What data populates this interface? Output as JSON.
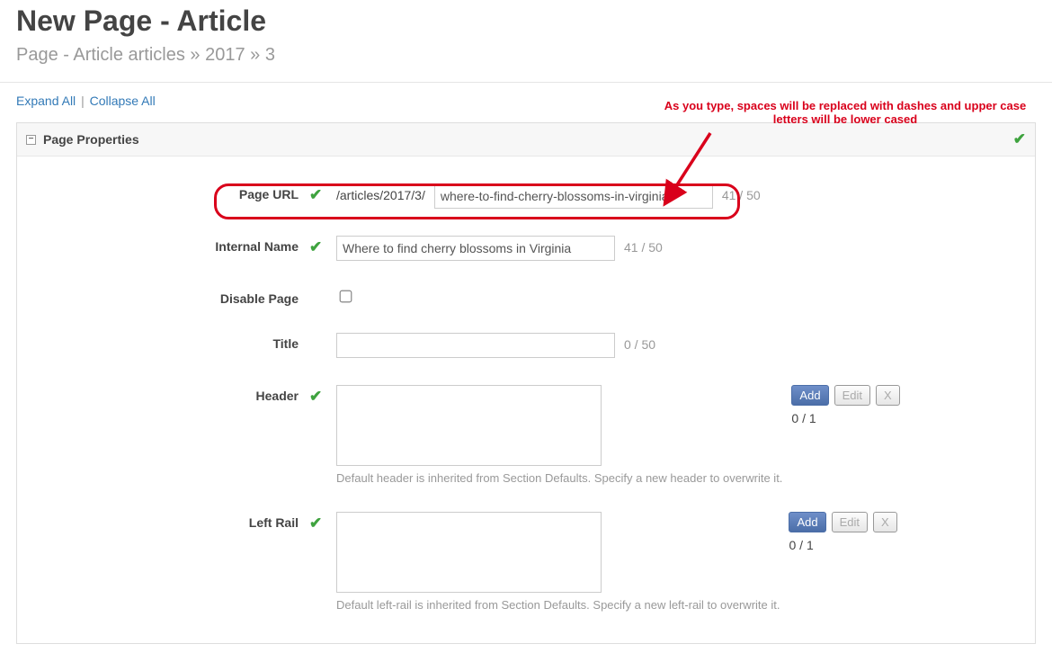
{
  "header": {
    "title": "New Page - Article",
    "breadcrumb": "Page - Article articles » 2017 » 3"
  },
  "toolbar": {
    "expand": "Expand All",
    "collapse": "Collapse All"
  },
  "annotation": {
    "text": "As you type, spaces will be replaced with dashes and upper case letters will be lower cased"
  },
  "panel": {
    "title": "Page Properties",
    "collapse_glyph": "⊟"
  },
  "fields": {
    "page_url": {
      "label": "Page URL",
      "prefix": "/articles/2017/3/",
      "value": "where-to-find-cherry-blossoms-in-virginia",
      "counter": "41 / 50"
    },
    "internal_name": {
      "label": "Internal Name",
      "value": "Where to find cherry blossoms in Virginia",
      "counter": "41 / 50"
    },
    "disable_page": {
      "label": "Disable Page"
    },
    "title": {
      "label": "Title",
      "value": "",
      "counter": "0 / 50"
    },
    "header": {
      "label": "Header",
      "count": "0 / 1",
      "helper": "Default header is inherited from Section Defaults. Specify a new header to overwrite it."
    },
    "left_rail": {
      "label": "Left Rail",
      "count": "0 / 1",
      "helper": "Default left-rail is inherited from Section Defaults. Specify a new left-rail to overwrite it."
    }
  },
  "buttons": {
    "add": "Add",
    "edit": "Edit",
    "x": "X"
  }
}
